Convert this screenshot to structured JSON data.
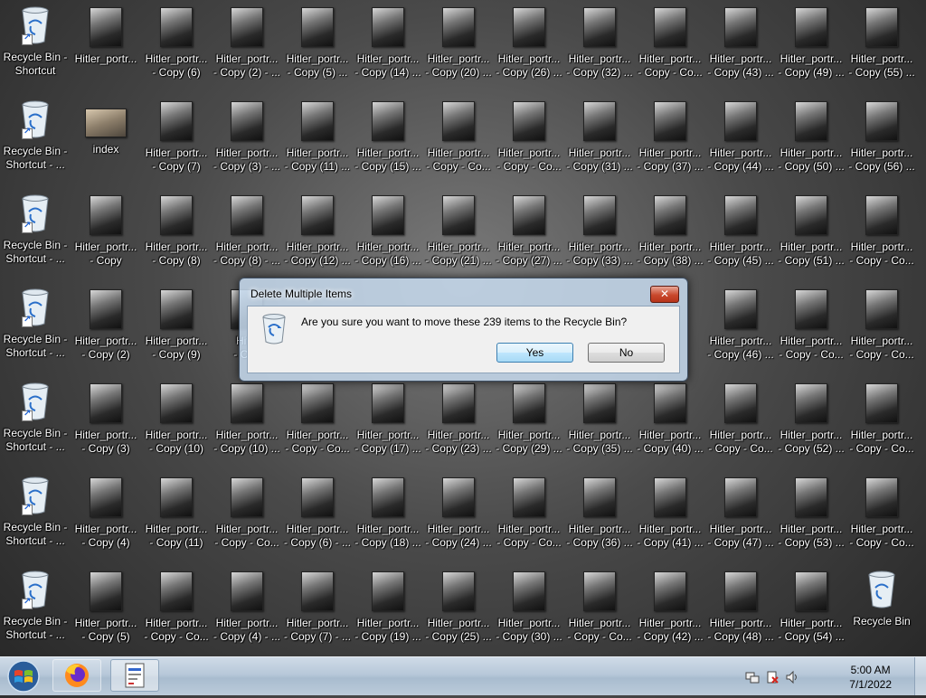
{
  "desktop": {
    "columns": [
      [
        "Recycle Bin - Shortcut",
        "Recycle Bin - Shortcut - ...",
        "Recycle Bin - Shortcut - ...",
        "Recycle Bin - Shortcut - ...",
        "Recycle Bin - Shortcut - ...",
        "Recycle Bin - Shortcut - ...",
        "Recycle Bin - Shortcut - ..."
      ],
      [
        "Hitler_portr...",
        "index",
        "Hitler_portr... - Copy",
        "Hitler_portr... - Copy (2)",
        "Hitler_portr... - Copy (3)",
        "Hitler_portr... - Copy (4)",
        "Hitler_portr... - Copy (5)"
      ],
      [
        "Hitler_portr... - Copy (6)",
        "Hitler_portr... - Copy (7)",
        "Hitler_portr... - Copy (8)",
        "Hitler_portr... - Copy (9)",
        "Hitler_portr... - Copy (10)",
        "Hitler_portr... - Copy (11)",
        "Hitler_portr... - Copy - Co..."
      ],
      [
        "Hitler_portr... - Copy (2) - ...",
        "Hitler_portr... - Copy (3) - ...",
        "Hitler_portr... - Copy (8) - ...",
        "Hitle - Cop",
        "Hitler_portr... - Copy (10) ...",
        "Hitler_portr... - Copy - Co...",
        "Hitler_portr... - Copy (4) - ..."
      ],
      [
        "Hitler_portr... - Copy (5) ...",
        "Hitler_portr... - Copy (11) ...",
        "Hitler_portr... - Copy (12) ...",
        "",
        "Hitler_portr... - Copy - Co...",
        "Hitler_portr... - Copy (6) - ...",
        "Hitler_portr... - Copy (7) - ..."
      ],
      [
        "Hitler_portr... - Copy (14) ...",
        "Hitler_portr... - Copy (15) ...",
        "Hitler_portr... - Copy (16) ...",
        "",
        "Hitler_portr... - Copy (17) ...",
        "Hitler_portr... - Copy (18) ...",
        "Hitler_portr... - Copy (19) ..."
      ],
      [
        "Hitler_portr... - Copy (20) ...",
        "Hitler_portr... - Copy - Co...",
        "Hitler_portr... - Copy (21) ...",
        "",
        "Hitler_portr... - Copy (23) ...",
        "Hitler_portr... - Copy (24) ...",
        "Hitler_portr... - Copy (25) ..."
      ],
      [
        "Hitler_portr... - Copy (26) ...",
        "Hitler_portr... - Copy - Co...",
        "Hitler_portr... - Copy (27) ...",
        "",
        "Hitler_portr... - Copy (29) ...",
        "Hitler_portr... - Copy - Co...",
        "Hitler_portr... - Copy (30) ..."
      ],
      [
        "Hitler_portr... - Copy (32) ...",
        "Hitler_portr... - Copy (31) ...",
        "Hitler_portr... - Copy (33) ...",
        "",
        "Hitler_portr... - Copy (35) ...",
        "Hitler_portr... - Copy (36) ...",
        "Hitler_portr... - Copy - Co..."
      ],
      [
        "Hitler_portr... - Copy - Co...",
        "Hitler_portr... - Copy (37) ...",
        "Hitler_portr... - Copy (38) ...",
        "",
        "Hitler_portr... - Copy (40) ...",
        "Hitler_portr... - Copy (41) ...",
        "Hitler_portr... - Copy (42) ..."
      ],
      [
        "Hitler_portr... - Copy (43) ...",
        "Hitler_portr... - Copy (44) ...",
        "Hitler_portr... - Copy (45) ...",
        "Hitler_portr... - Copy (46) ...",
        "Hitler_portr... - Copy - Co...",
        "Hitler_portr... - Copy (47) ...",
        "Hitler_portr... - Copy (48) ..."
      ],
      [
        "Hitler_portr... - Copy (49) ...",
        "Hitler_portr... - Copy (50) ...",
        "Hitler_portr... - Copy (51) ...",
        "Hitler_portr... - Copy - Co...",
        "Hitler_portr... - Copy (52) ...",
        "Hitler_portr... - Copy (53) ...",
        "Hitler_portr... - Copy (54) ..."
      ],
      [
        "Hitler_portr... - Copy (55) ...",
        "Hitler_portr... - Copy (56) ...",
        "Hitler_portr... - Copy - Co...",
        "Hitler_portr... - Copy - Co...",
        "Hitler_portr... - Copy - Co...",
        "Hitler_portr... - Copy - Co...",
        "Recycle Bin"
      ]
    ]
  },
  "dialog": {
    "title": "Delete Multiple Items",
    "close_label": "✕",
    "message": "Are you sure you want to move these 239 items to the Recycle Bin?",
    "yes_label": "Yes",
    "no_label": "No"
  },
  "taskbar": {
    "time": "5:00 AM",
    "date": "7/1/2022"
  }
}
